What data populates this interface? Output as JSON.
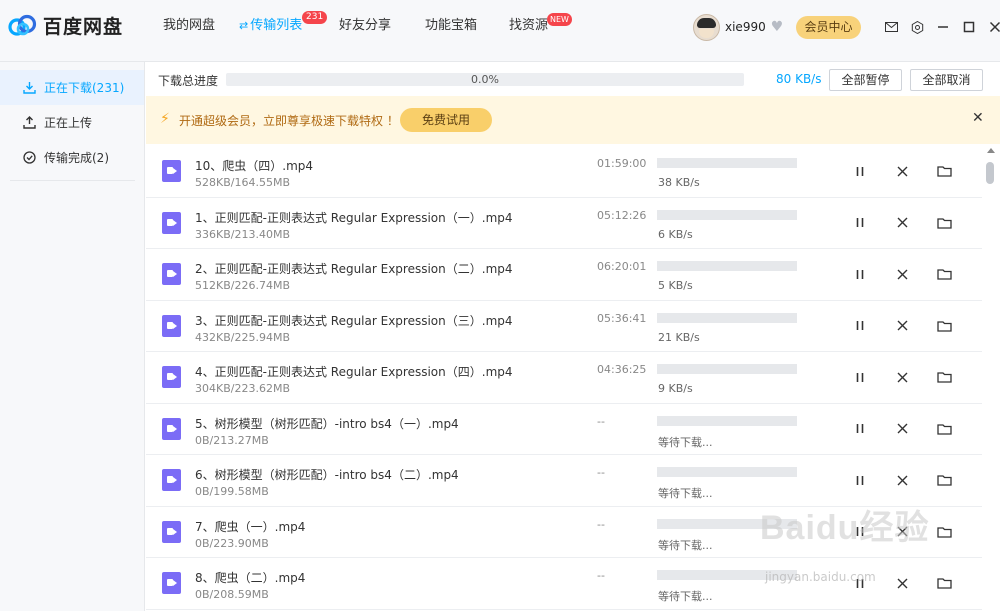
{
  "app": {
    "name": "百度网盘",
    "brand_color": "#06a7ff",
    "logo_icon": "baidu-cloud-logo-icon"
  },
  "nav": [
    {
      "label": "我的网盘",
      "active": false
    },
    {
      "label": "传输列表",
      "active": true,
      "badge": "231",
      "icon": "transfer-arrows-icon"
    },
    {
      "label": "好友分享",
      "active": false
    },
    {
      "label": "功能宝箱",
      "active": false
    },
    {
      "label": "找资源",
      "active": false,
      "badge": "NEW"
    }
  ],
  "user": {
    "name": "xie990",
    "vip_label": "会员中心"
  },
  "window_icons": [
    "mail-icon",
    "settings-icon",
    "minimize-icon",
    "maximize-icon",
    "close-icon"
  ],
  "sidebar": [
    {
      "label": "正在下载(231)",
      "icon": "download-icon",
      "active": true
    },
    {
      "label": "正在上传",
      "icon": "upload-icon",
      "active": false
    },
    {
      "label": "传输完成(2)",
      "icon": "check-circle-icon",
      "active": false
    }
  ],
  "total": {
    "label": "下载总进度",
    "percent": "0.0%",
    "progress": 0,
    "speed": "80 KB/s",
    "pause_all": "全部暂停",
    "cancel_all": "全部取消"
  },
  "promo": {
    "text": "开通超级会员，立即尊享极速下载特权 ！",
    "button": "免费试用"
  },
  "files": [
    {
      "name": "10、爬虫（四）.mp4",
      "size": "528KB/164.55MB",
      "time": "01:59:00",
      "speed": "38 KB/s"
    },
    {
      "name": "1、正则匹配-正则表达式 Regular Expression（一）.mp4",
      "size": "336KB/213.40MB",
      "time": "05:12:26",
      "speed": "6 KB/s"
    },
    {
      "name": "2、正则匹配-正则表达式 Regular Expression（二）.mp4",
      "size": "512KB/226.74MB",
      "time": "06:20:01",
      "speed": "5 KB/s"
    },
    {
      "name": "3、正则匹配-正则表达式 Regular Expression（三）.mp4",
      "size": "432KB/225.94MB",
      "time": "05:36:41",
      "speed": "21 KB/s"
    },
    {
      "name": "4、正则匹配-正则表达式 Regular Expression（四）.mp4",
      "size": "304KB/223.62MB",
      "time": "04:36:25",
      "speed": "9 KB/s"
    },
    {
      "name": "5、树形模型（树形匹配）-intro bs4（一）.mp4",
      "size": "0B/213.27MB",
      "time": "--",
      "speed": "等待下载..."
    },
    {
      "name": "6、树形模型（树形匹配）-intro bs4（二）.mp4",
      "size": "0B/199.58MB",
      "time": "--",
      "speed": "等待下载..."
    },
    {
      "name": "7、爬虫（一）.mp4",
      "size": "0B/223.90MB",
      "time": "--",
      "speed": "等待下载..."
    },
    {
      "name": "8、爬虫（二）.mp4",
      "size": "0B/208.59MB",
      "time": "--",
      "speed": "等待下载..."
    }
  ],
  "row_actions": [
    "pause-icon",
    "cancel-icon",
    "folder-icon"
  ],
  "watermark": {
    "text": "Baidu经验",
    "sub": "jingyan.baidu.com"
  }
}
